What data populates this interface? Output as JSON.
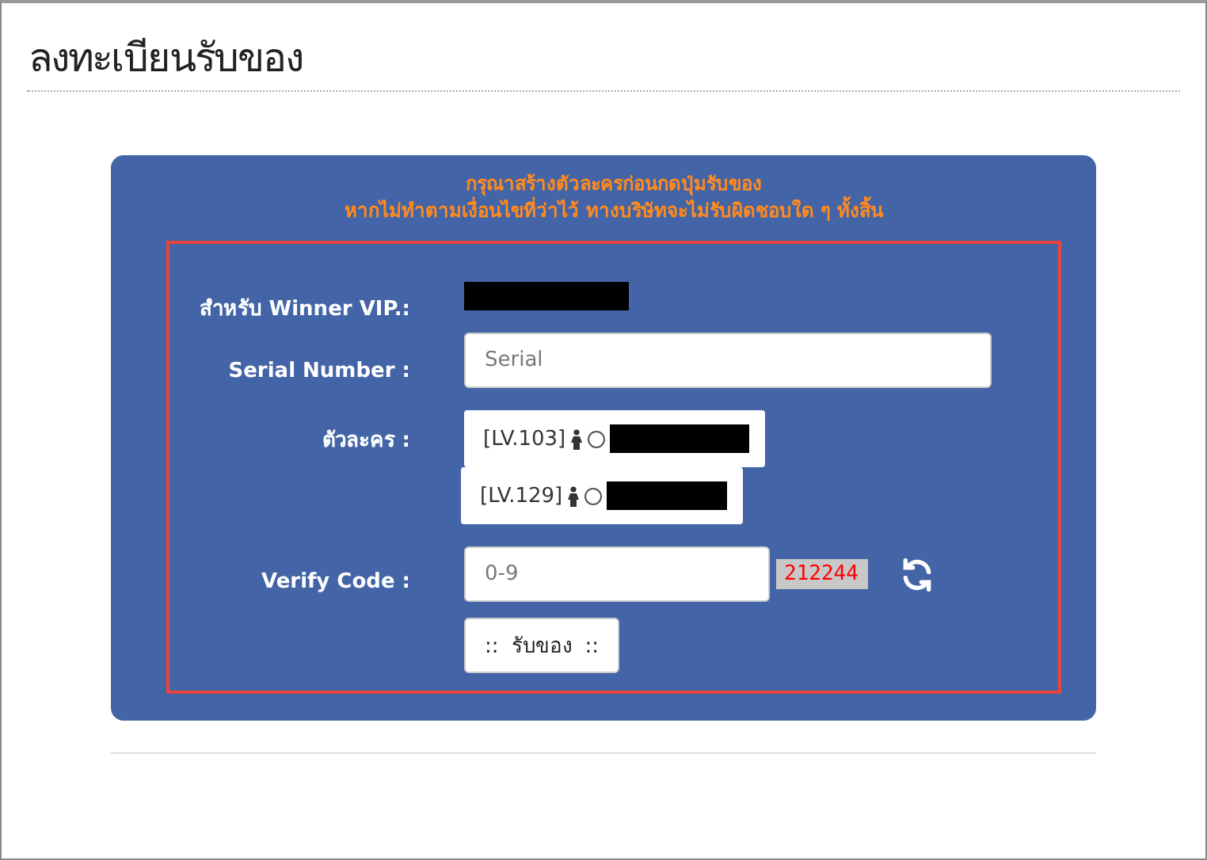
{
  "page": {
    "title": "ลงทะเบียนรับของ"
  },
  "notice": [
    "กรุณาสร้างตัวละครก่อนกดปุ่มรับของ",
    "หากไม่ทำตามเงื่อนไขที่ว่าไว้ ทางบริษัทจะไม่รับผิดชอบใด ๆ ทั้งสิ้น"
  ],
  "vip": {
    "label": "สำหรับ Winner VIP.:"
  },
  "serial": {
    "label": "Serial Number :",
    "placeholder": "Serial"
  },
  "characters": {
    "label": "ตัวละคร :",
    "options": [
      {
        "level": "[LV.103]",
        "selected": false
      },
      {
        "level": "[LV.129]",
        "selected": false
      }
    ]
  },
  "verify": {
    "label": "Verify Code :",
    "placeholder": "0-9",
    "code": "212244"
  },
  "submit": "::  รับของ  ::"
}
